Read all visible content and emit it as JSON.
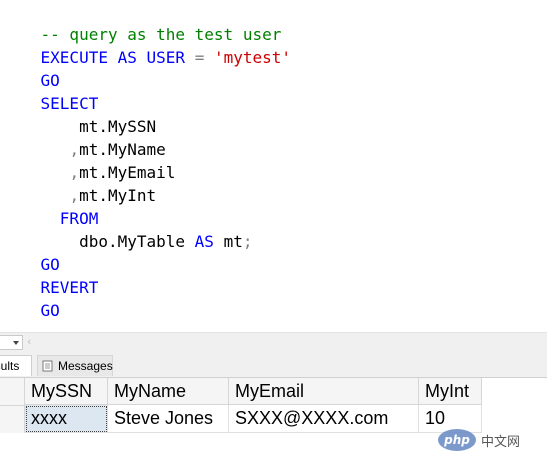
{
  "editor": {
    "lines": {
      "l1": {
        "comment": "-- query as the test user"
      },
      "l2": {
        "execute": "EXECUTE",
        "as": "AS",
        "user": "USER",
        "eq": "=",
        "value": "'mytest'"
      },
      "l3": {
        "go": "GO"
      },
      "l4": {
        "select": "SELECT"
      },
      "l5": {
        "col": "mt.MySSN"
      },
      "l6": {
        "comma": ",",
        "col": "mt.MyName"
      },
      "l7": {
        "comma": ",",
        "col": "mt.MyEmail"
      },
      "l8": {
        "comma": ",",
        "col": "mt.MyInt"
      },
      "l9": {
        "from": "FROM"
      },
      "l10": {
        "table": "dbo.MyTable",
        "as": "AS",
        "alias": "mt",
        "semi": ";"
      },
      "l11": {
        "go": "GO"
      },
      "l12": {
        "revert": "REVERT"
      },
      "l13": {
        "go": "GO"
      }
    }
  },
  "results_panel": {
    "tabs": {
      "results": {
        "label": "Results",
        "visible_label": "esults",
        "icon": "grid-icon"
      },
      "messages": {
        "label": "Messages",
        "icon": "messages-icon"
      }
    },
    "grid": {
      "columns": [
        "MySSN",
        "MyName",
        "MyEmail",
        "MyInt"
      ],
      "rows": [
        [
          "xxxx",
          "Steve Jones",
          "SXXX@XXXX.com",
          "10"
        ]
      ]
    }
  },
  "watermark": {
    "logo": "php",
    "text": "中文网"
  },
  "colors": {
    "keyword": "#0000ff",
    "string": "#cc0000",
    "comment": "#008000",
    "operator": "#808080"
  }
}
